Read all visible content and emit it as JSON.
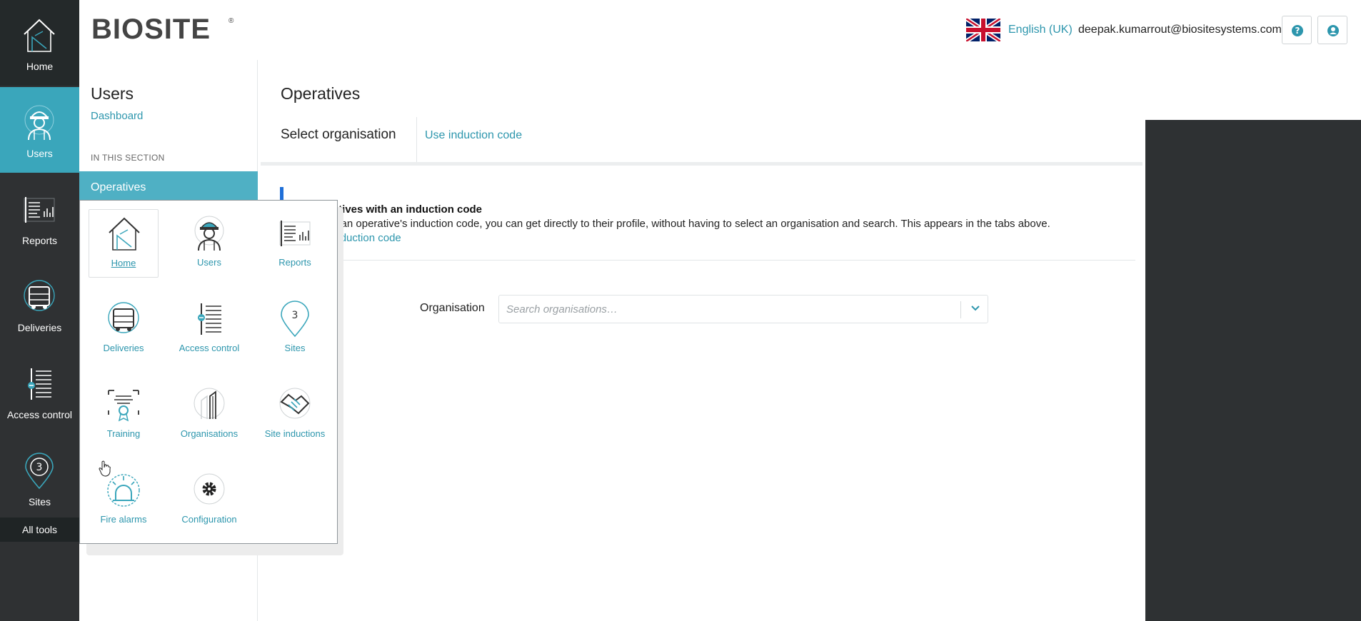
{
  "rail": {
    "home": "Home",
    "users": "Users",
    "reports": "Reports",
    "deliveries": "Deliveries",
    "access_control": "Access control",
    "sites": "Sites",
    "all_tools": "All tools"
  },
  "header": {
    "logo": "BIOSITE",
    "language": "English (UK)",
    "email": "deepak.kumarrout@biositesystems.com",
    "help_icon": "help-icon",
    "account_icon": "account-icon"
  },
  "subnav": {
    "title": "Users",
    "dashboard": "Dashboard",
    "section_label": "IN THIS SECTION",
    "active_item": "Operatives"
  },
  "main": {
    "title": "Operatives",
    "tab_select": "Select organisation",
    "tab_code": "Use induction code",
    "info_heading": "d operatives with an induction code",
    "info_body": "ou have an operative's induction code, you can get directly to their profile, without having to select an organisation and search. This appears in the tabs above.",
    "info_link": "rch by induction code",
    "org_label": "Organisation",
    "org_placeholder": "Search organisations…"
  },
  "popup": {
    "tools": [
      {
        "label": "Home",
        "icon": "home-icon"
      },
      {
        "label": "Users",
        "icon": "users-icon"
      },
      {
        "label": "Reports",
        "icon": "reports-icon"
      },
      {
        "label": "Deliveries",
        "icon": "deliveries-icon"
      },
      {
        "label": "Access control",
        "icon": "access-control-icon"
      },
      {
        "label": "Sites",
        "icon": "sites-icon"
      },
      {
        "label": "Training",
        "icon": "training-icon"
      },
      {
        "label": "Organisations",
        "icon": "organisations-icon"
      },
      {
        "label": "Site inductions",
        "icon": "site-inductions-icon"
      },
      {
        "label": "Fire alarms",
        "icon": "fire-alarms-icon"
      },
      {
        "label": "Configuration",
        "icon": "configuration-icon"
      }
    ]
  },
  "colors": {
    "accent": "#2d96ad",
    "rail": "#2f3133",
    "rail_active": "#3aa6bb",
    "subnav_active": "#4fb0c4"
  }
}
